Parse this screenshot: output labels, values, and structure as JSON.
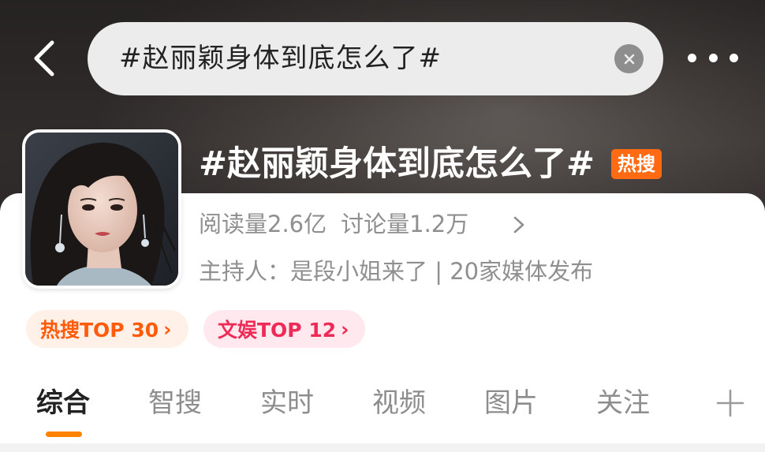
{
  "search": {
    "query": "#赵丽颖身体到底怎么了#"
  },
  "topic": {
    "title": "#赵丽颖身体到底怎么了#",
    "hot_badge": "热搜",
    "reads": "阅读量2.6亿",
    "discussions": "讨论量1.2万",
    "host_line": "主持人：是段小姐来了 | 20家媒体发布"
  },
  "rank_pills": [
    {
      "label": "热搜TOP 30",
      "chevron": "›"
    },
    {
      "label": "文娱TOP 12",
      "chevron": "›"
    }
  ],
  "tabs": [
    {
      "label": "综合"
    },
    {
      "label": "智搜"
    },
    {
      "label": "实时"
    },
    {
      "label": "视频"
    },
    {
      "label": "图片"
    },
    {
      "label": "关注"
    }
  ],
  "icons": {
    "back": "back-arrow-icon",
    "clear": "clear-icon",
    "more": "more-dots-icon",
    "stats": "chevron-right-icon",
    "add": "plus-icon"
  },
  "colors": {
    "hot_badge": "#ff6a12",
    "hot_pill_text": "#ff5b0a",
    "ent_pill_text": "#ee2a56",
    "tab_indicator": "#ff8200"
  }
}
